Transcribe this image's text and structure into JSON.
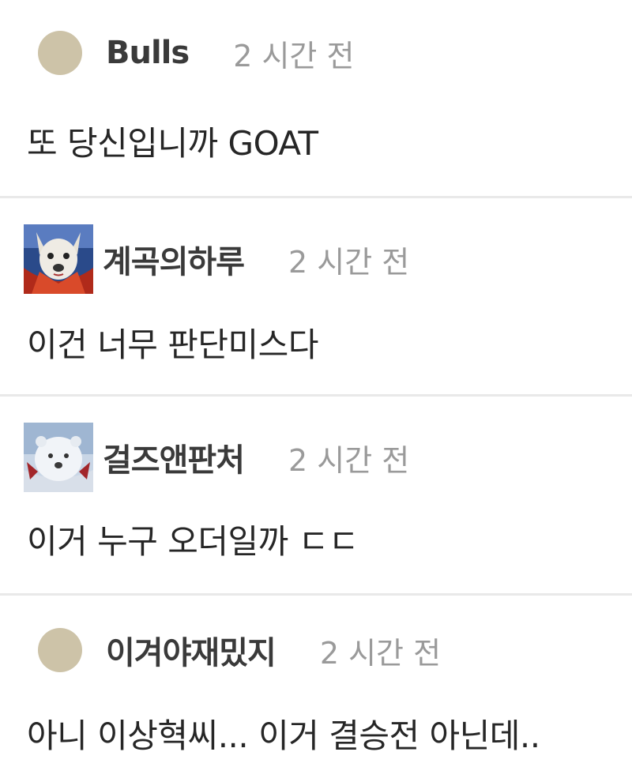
{
  "comments": [
    {
      "nickname": "Bulls",
      "time": "2 시간 전",
      "text": "또 당신입니까 GOAT",
      "avatar": "default-avatar-circle"
    },
    {
      "nickname": "계곡의하루",
      "time": "2 시간 전",
      "text": "이건 너무 판단미스다",
      "avatar": "dog-avatar"
    },
    {
      "nickname": "걸즈앤판처",
      "time": "2 시간 전",
      "text": "이거 누구 오더일까 ㄷㄷ",
      "avatar": "polar-bear-avatar"
    },
    {
      "nickname": "이겨야재밌지",
      "time": "2 시간 전",
      "text": "아니 이상혁씨... 이거 결승전 아닌데..",
      "avatar": "default-avatar-circle"
    }
  ],
  "colors": {
    "background": "#ffffff",
    "divider": "#e9e9e9",
    "nickname": "#3a3a3a",
    "time": "#9a9a9a",
    "default_avatar": "#cdc3a8"
  }
}
